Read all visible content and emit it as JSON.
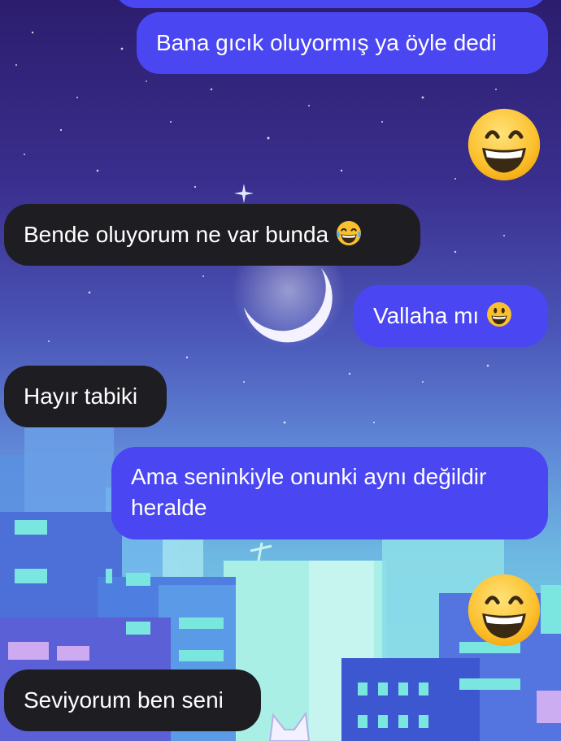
{
  "conversation": {
    "messages": [
      {
        "id": "m1",
        "side": "sent",
        "text": "Bana gıcık oluyormış ya öyle dedi"
      },
      {
        "id": "m2",
        "side": "sent",
        "emoji": "grinning-smiling-eyes-emoji"
      },
      {
        "id": "m3",
        "side": "received",
        "text": "Bende oluyorum ne var bunda",
        "emoji": "tears-of-joy-emoji"
      },
      {
        "id": "m4",
        "side": "sent",
        "text": "Vallaha mı",
        "emoji": "grinning-big-eyes-emoji"
      },
      {
        "id": "m5",
        "side": "received",
        "text": "Hayır tabiki"
      },
      {
        "id": "m6",
        "side": "sent",
        "text_line1": "Ama seninkiyle onunki aynı değildir",
        "text_line2": "heralde"
      },
      {
        "id": "m7",
        "side": "sent",
        "emoji": "grinning-smiling-eyes-emoji"
      },
      {
        "id": "m8",
        "side": "received",
        "text": "Seviyorum ben seni"
      }
    ]
  },
  "theme": {
    "sent_bubble_color": "#4a46f2",
    "received_bubble_color": "#1d1d22",
    "text_color": "#ffffff",
    "wallpaper": "night-sky-city-moon"
  }
}
